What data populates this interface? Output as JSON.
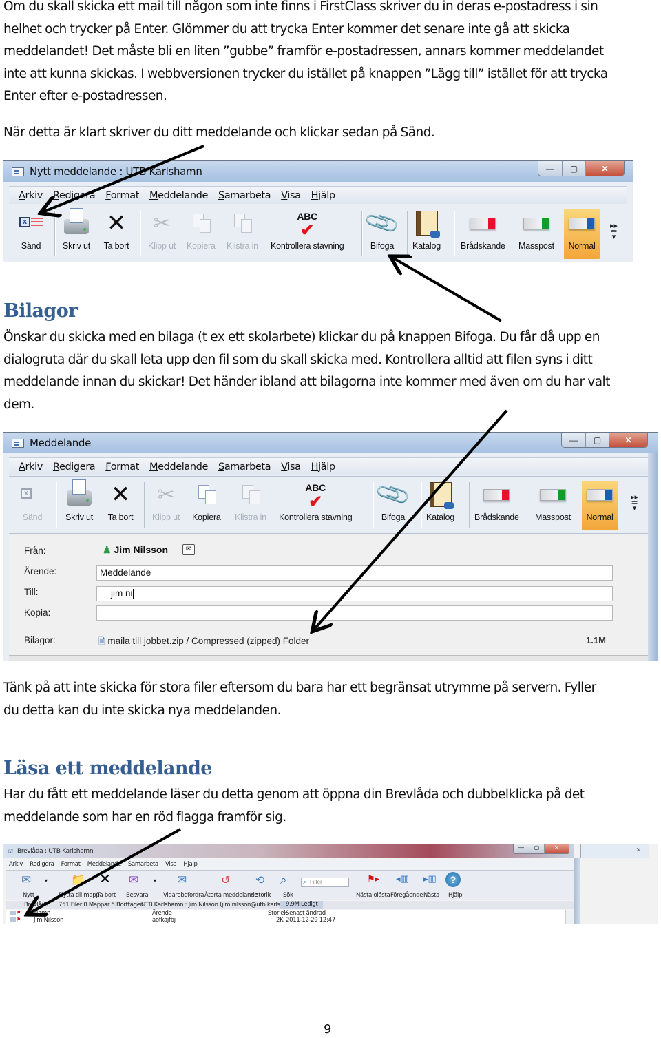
{
  "paragraphs": {
    "intro": [
      "Om du skall skicka ett mail till någon som inte finns i FirstClass skriver du in deras e-postadress i sin",
      "helhet och trycker på Enter. Glömmer du att trycka Enter kommer det senare inte gå att skicka",
      "meddelandet! Det måste bli en liten ”gubbe” framför e-postadressen, annars kommer meddelandet",
      "inte att kunna skickas. I webbversionen trycker du istället på knappen ”Lägg till” istället för att trycka",
      "Enter efter e-postadressen."
    ],
    "send": "När detta är klart skriver du ditt meddelande och klickar sedan på Sänd.",
    "attach": [
      "Önskar du skicka med en bilaga (t ex ett skolarbete) klickar du på knappen Bifoga. Du får då upp en",
      "dialogruta där du skall leta upp den fil som du skall skicka med. Kontrollera alltid att filen syns i ditt",
      "meddelande innan du skickar! Det händer ibland att bilagorna inte kommer med även om du har valt",
      "dem."
    ],
    "size_warning": [
      "Tänk på att inte skicka för stora filer eftersom du bara har ett begränsat utrymme på servern. Fyller",
      "du detta kan du inte skicka nya meddelanden."
    ],
    "read": [
      "Har du fått ett meddelande läser du detta genom att öppna din Brevlåda och dubbelklicka på det",
      "meddelande som har en röd flagga framför sig."
    ]
  },
  "headings": {
    "attachments": "Bilagor",
    "read": "Läsa ett meddelande"
  },
  "page_number": "9",
  "menus": [
    "Arkiv",
    "Redigera",
    "Format",
    "Meddelande",
    "Samarbeta",
    "Visa",
    "Hjälp"
  ],
  "window_controls": {
    "minimize": "—",
    "maximize": "▢",
    "close": "✕"
  },
  "screenshot1": {
    "title": "Nytt meddelande : UTB Karlshamn",
    "toolbar": {
      "send": "Sänd",
      "print": "Skriv ut",
      "delete": "Ta bort",
      "cut": "Klipp ut",
      "copy": "Kopiera",
      "paste": "Klistra in",
      "spellcheck": "Kontrollera stavning",
      "attach": "Bifoga",
      "catalog": "Katalog",
      "urgent": "Brådskande",
      "bulk": "Masspost",
      "normal": "Normal"
    }
  },
  "screenshot2": {
    "title": "Meddelande",
    "toolbar": {
      "send": "Sänd",
      "print": "Skriv ut",
      "delete": "Ta bort",
      "cut": "Klipp ut",
      "copy": "Kopiera",
      "paste": "Klistra in",
      "spellcheck": "Kontrollera stavning",
      "attach": "Bifoga",
      "catalog": "Katalog",
      "urgent": "Brådskande",
      "bulk": "Masspost",
      "normal": "Normal"
    },
    "form": {
      "from_label": "Från:",
      "from_value": "Jim Nilsson",
      "subject_label": "Ärende:",
      "subject_value": "Meddelande",
      "to_label": "Till:",
      "to_value": "jim ni",
      "cc_label": "Kopia:",
      "cc_value": "",
      "attachments_label": "Bilagor:",
      "attachment_name": "maila till jobbet.zip / Compressed (zipped) Folder",
      "attachment_size": "1.1M"
    }
  },
  "screenshot3": {
    "title": "Brevlåda : UTB Karlshamn",
    "menus": [
      "Arkiv",
      "Redigera",
      "Format",
      "Meddelande",
      "Samarbeta",
      "Visa",
      "Hjalp"
    ],
    "toolbar": {
      "new": "Nytt",
      "move": "Flytta till mapp",
      "delete": "Ta bort",
      "reply": "Besvara",
      "forward": "Vidarebefordra",
      "recall": "Återta meddelande",
      "history": "Historik",
      "search": "Sök",
      "filter_placeholder": "Filter",
      "next_unread": "Nästa olästa",
      "previous": "Föregående",
      "next": "Nästa",
      "help": "Hjälp"
    },
    "status": {
      "path": "Brevlåda",
      "counts": "751 Filer  0 Mappar  5 Borttagen",
      "account": "UTB Karlshamn : Jim Nilsson (jim.nilsson@utb.karlshamn.se)",
      "free": "9.9M Ledigt"
    },
    "columns": {
      "name": "Namn",
      "subject": "Ärende",
      "size": "Storlek",
      "modified": "Senast ändrad"
    },
    "rows": [
      {
        "name": "Jim Nilsson",
        "subject": "aöfkajfbj",
        "size": "2K",
        "modified": "2011-12-29  12:47"
      }
    ],
    "colors": {
      "flag": "#d0141a"
    }
  }
}
